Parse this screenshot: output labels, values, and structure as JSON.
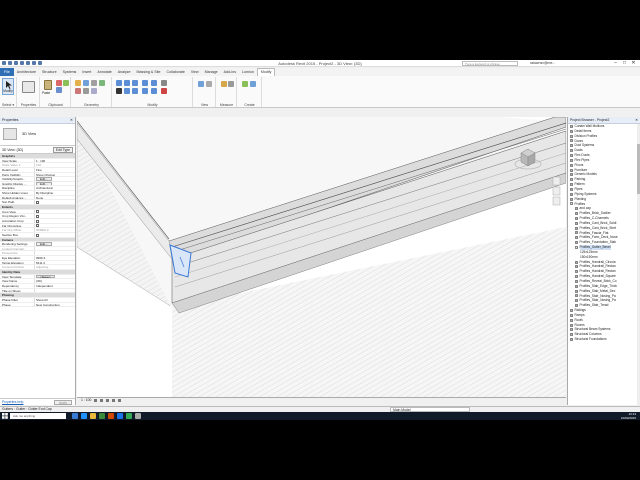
{
  "window": {
    "title": "Autodesk Revit 2015 -   Project2 - 3D View: {3D}",
    "search_placeholder": "Type a keyword or phrase",
    "user": "rakavnsv@me...",
    "controls": [
      "–",
      "□",
      "✕"
    ]
  },
  "tabs": [
    "File",
    "Architecture",
    "Structure",
    "Systems",
    "Insert",
    "Annotate",
    "Analyze",
    "Massing & Site",
    "Collaborate",
    "View",
    "Manage",
    "Add-Ins",
    "Lumion",
    "Modify"
  ],
  "active_tab": "Modify",
  "ribbon": {
    "modify_label": "Modify",
    "paste_label": "Paste",
    "groups": [
      "Select ▾",
      "Properties",
      "Clipboard",
      "Geometry",
      "Modify",
      "View",
      "Measure",
      "Create"
    ]
  },
  "properties": {
    "title": "Properties",
    "close": "✕",
    "type_name": "3D View",
    "view_selector": "3D View: {3D}",
    "edit_type": "Edit Type",
    "rows": [
      {
        "k": "Graphics",
        "v": "",
        "sec": true
      },
      {
        "k": "View Scale",
        "v": "1 : 100"
      },
      {
        "k": "Scale Value    1:",
        "v": "100",
        "grey": true
      },
      {
        "k": "Detail Level",
        "v": "Fine"
      },
      {
        "k": "Parts Visibility",
        "v": "Show Original"
      },
      {
        "k": "Visibility/Graphi...",
        "v": "Edit...",
        "btn": true
      },
      {
        "k": "Graphic Display ...",
        "v": "Edit...",
        "btn": true
      },
      {
        "k": "Discipline",
        "v": "Architectural"
      },
      {
        "k": "Show Hidden Lines",
        "v": "By Discipline"
      },
      {
        "k": "Default Analysis ...",
        "v": "None"
      },
      {
        "k": "Sun Path",
        "v": "",
        "chk": true
      },
      {
        "k": "Extents",
        "v": "",
        "sec": true
      },
      {
        "k": "Crop View",
        "v": "",
        "chk": true
      },
      {
        "k": "Crop Region Visi...",
        "v": "",
        "chk": true
      },
      {
        "k": "Annotation Crop",
        "v": "",
        "chk": true
      },
      {
        "k": "Far Clip Active",
        "v": "",
        "chk": true
      },
      {
        "k": "Far Clip Offset",
        "v": "304800.0",
        "grey": true
      },
      {
        "k": "Section Box",
        "v": "",
        "chk": true
      },
      {
        "k": "Camera",
        "v": "",
        "sec": true
      },
      {
        "k": "Rendering Settings",
        "v": "Edit...",
        "btn": true
      },
      {
        "k": "Locked Orientati...",
        "v": "",
        "grey": true
      },
      {
        "k": "Perspective",
        "v": "",
        "grey": true
      },
      {
        "k": "Eye Elevation",
        "v": "9966.4"
      },
      {
        "k": "Target Elevation",
        "v": "5411.3"
      },
      {
        "k": "Camera Position",
        "v": "Adjusting",
        "grey": true
      },
      {
        "k": "Identity Data",
        "v": "",
        "sec": true
      },
      {
        "k": "View Template",
        "v": "<None>",
        "btn": true
      },
      {
        "k": "View Name",
        "v": "{3D}"
      },
      {
        "k": "Dependency",
        "v": "Independent"
      },
      {
        "k": "Title on Sheet",
        "v": ""
      },
      {
        "k": "Phasing",
        "v": "",
        "sec": true
      },
      {
        "k": "Phase Filter",
        "v": "Show All"
      },
      {
        "k": "Phase",
        "v": "New Construction"
      }
    ],
    "help_link": "Properties help",
    "apply": "Apply"
  },
  "viewbar": {
    "scale": "1 : 100"
  },
  "browser": {
    "title": "Project Browser - Project2",
    "close": "✕",
    "items": [
      {
        "t": "Curtain Wall Mullions",
        "lvl": 0,
        "tog": "+"
      },
      {
        "t": "Detail Items",
        "lvl": 0,
        "tog": "+"
      },
      {
        "t": "Division Profiles",
        "lvl": 0,
        "tog": "+"
      },
      {
        "t": "Doors",
        "lvl": 0,
        "tog": "+"
      },
      {
        "t": "Duct Systems",
        "lvl": 0,
        "tog": "+"
      },
      {
        "t": "Ducts",
        "lvl": 0,
        "tog": "+"
      },
      {
        "t": "Flex Ducts",
        "lvl": 0,
        "tog": "+"
      },
      {
        "t": "Flex Pipes",
        "lvl": 0,
        "tog": "+"
      },
      {
        "t": "Floors",
        "lvl": 0,
        "tog": "+"
      },
      {
        "t": "Furniture",
        "lvl": 0,
        "tog": "+"
      },
      {
        "t": "Generic Models",
        "lvl": 0,
        "tog": "+"
      },
      {
        "t": "Parking",
        "lvl": 0,
        "tog": "+"
      },
      {
        "t": "Pattern",
        "lvl": 0,
        "tog": "+"
      },
      {
        "t": "Pipes",
        "lvl": 0,
        "tog": "+"
      },
      {
        "t": "Piping Systems",
        "lvl": 0,
        "tog": "+"
      },
      {
        "t": "Planting",
        "lvl": 0,
        "tog": "+"
      },
      {
        "t": "Profiles",
        "lvl": 0,
        "tog": "−"
      },
      {
        "t": "and cap",
        "lvl": 1,
        "tog": "+"
      },
      {
        "t": "Profiles_Brick_Soldier",
        "lvl": 1,
        "tog": "+"
      },
      {
        "t": "Profiles_C-Channels",
        "lvl": 1,
        "tog": "+"
      },
      {
        "t": "Profiles_Cant_Brick_Soldi",
        "lvl": 1,
        "tog": "+"
      },
      {
        "t": "Profiles_Cant_Brick_Stret",
        "lvl": 1,
        "tog": "+"
      },
      {
        "t": "Profiles_Fascia_Flat",
        "lvl": 1,
        "tog": "+"
      },
      {
        "t": "Profiles_Form_Deck_Nose",
        "lvl": 1,
        "tog": "+"
      },
      {
        "t": "Profiles_Foundation_Slab",
        "lvl": 1,
        "tog": "+"
      },
      {
        "t": "Profiles_Gutter_Bevel",
        "lvl": 1,
        "tog": "−"
      },
      {
        "t": "125x125mm",
        "lvl": 2,
        "tog": ""
      },
      {
        "t": "150x150mm",
        "lvl": 2,
        "tog": ""
      },
      {
        "t": "Profiles_Handrail_Circula",
        "lvl": 1,
        "tog": "+"
      },
      {
        "t": "Profiles_Handrail_Rectan",
        "lvl": 1,
        "tog": "+"
      },
      {
        "t": "Profiles_Handrail_Rectan",
        "lvl": 1,
        "tog": "+"
      },
      {
        "t": "Profiles_Handrail_Square",
        "lvl": 1,
        "tog": "+"
      },
      {
        "t": "Profiles_Reveal_Brick_Co",
        "lvl": 1,
        "tog": "+"
      },
      {
        "t": "Profiles_Slab_Edge_Thick",
        "lvl": 1,
        "tog": "+"
      },
      {
        "t": "Profiles_Slab_Metal_Dec",
        "lvl": 1,
        "tog": "+"
      },
      {
        "t": "Profiles_Stair_Nosing_Pa",
        "lvl": 1,
        "tog": "+"
      },
      {
        "t": "Profiles_Stair_Nosing_Pa",
        "lvl": 1,
        "tog": "+"
      },
      {
        "t": "Profiles_Stair_Tread",
        "lvl": 1,
        "tog": "+"
      },
      {
        "t": "Railings",
        "lvl": 0,
        "tog": "+"
      },
      {
        "t": "Ramps",
        "lvl": 0,
        "tog": "+"
      },
      {
        "t": "Roofs",
        "lvl": 0,
        "tog": "+"
      },
      {
        "t": "Rooms",
        "lvl": 0,
        "tog": "+"
      },
      {
        "t": "Structural Beam Systems",
        "lvl": 0,
        "tog": "+"
      },
      {
        "t": "Structural Columns",
        "lvl": 0,
        "tog": "+"
      },
      {
        "t": "Structural Foundations",
        "lvl": 0,
        "tog": "+"
      }
    ]
  },
  "status": {
    "left": "Gutters : Gutter : Gutter End Cap",
    "model": "Main Model"
  },
  "taskbar": {
    "search": "Ask me anything",
    "time": "13:13",
    "date": "10/02/2016"
  },
  "colors": {
    "accent": "#2f6fb5",
    "selection": "#3a78d4"
  }
}
